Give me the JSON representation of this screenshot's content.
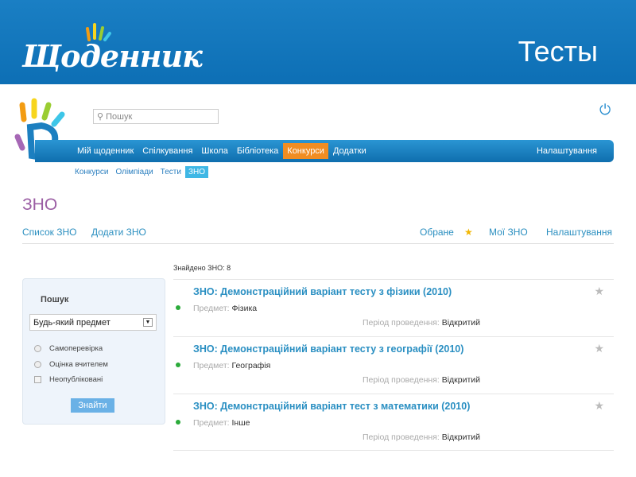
{
  "banner": {
    "brand": "Щоденник",
    "slide_title": "Тесты"
  },
  "header": {
    "search_placeholder": "Пошук"
  },
  "nav": {
    "items": [
      "Мій щоденник",
      "Спілкування",
      "Школа",
      "Бібліотека",
      "Конкурси",
      "Додатки"
    ],
    "active": "Конкурси",
    "right": "Налаштування"
  },
  "subnav": {
    "items": [
      "Конкурси",
      "Олімпіади",
      "Тести",
      "ЗНО"
    ],
    "active": "ЗНО"
  },
  "page_title": "ЗНО",
  "tabs": {
    "list": "Список ЗНО",
    "add": "Додати ЗНО",
    "favorites": "Обране",
    "mine": "Мої ЗНО",
    "settings": "Налаштування"
  },
  "search_panel": {
    "title": "Пошук",
    "subject_select": "Будь-який предмет",
    "options": [
      "Самоперевірка",
      "Оцінка вчителем"
    ],
    "checkbox": "Неопубліковані",
    "button": "Знайти"
  },
  "results": {
    "found": "Знайдено ЗНО: 8",
    "subject_label": "Предмет:",
    "period_label": "Період проведення:",
    "items": [
      {
        "title": "ЗНО: Демонстраційний варіант тесту з фізики (2010)",
        "subject": "Фізика",
        "period": "Відкритий"
      },
      {
        "title": "ЗНО: Демонстраційний варіант тесту з географії (2010)",
        "subject": "Географія",
        "period": "Відкритий"
      },
      {
        "title": "ЗНО: Демонстраційний варіант тест з математики (2010)",
        "subject": "Інше",
        "period": "Відкритий"
      }
    ]
  },
  "colors": {
    "banner": "#1a7fc4",
    "nav": "#1a86c7",
    "active_nav": "#f18d22",
    "title": "#9b5ea4",
    "link": "#2a8fc2"
  }
}
